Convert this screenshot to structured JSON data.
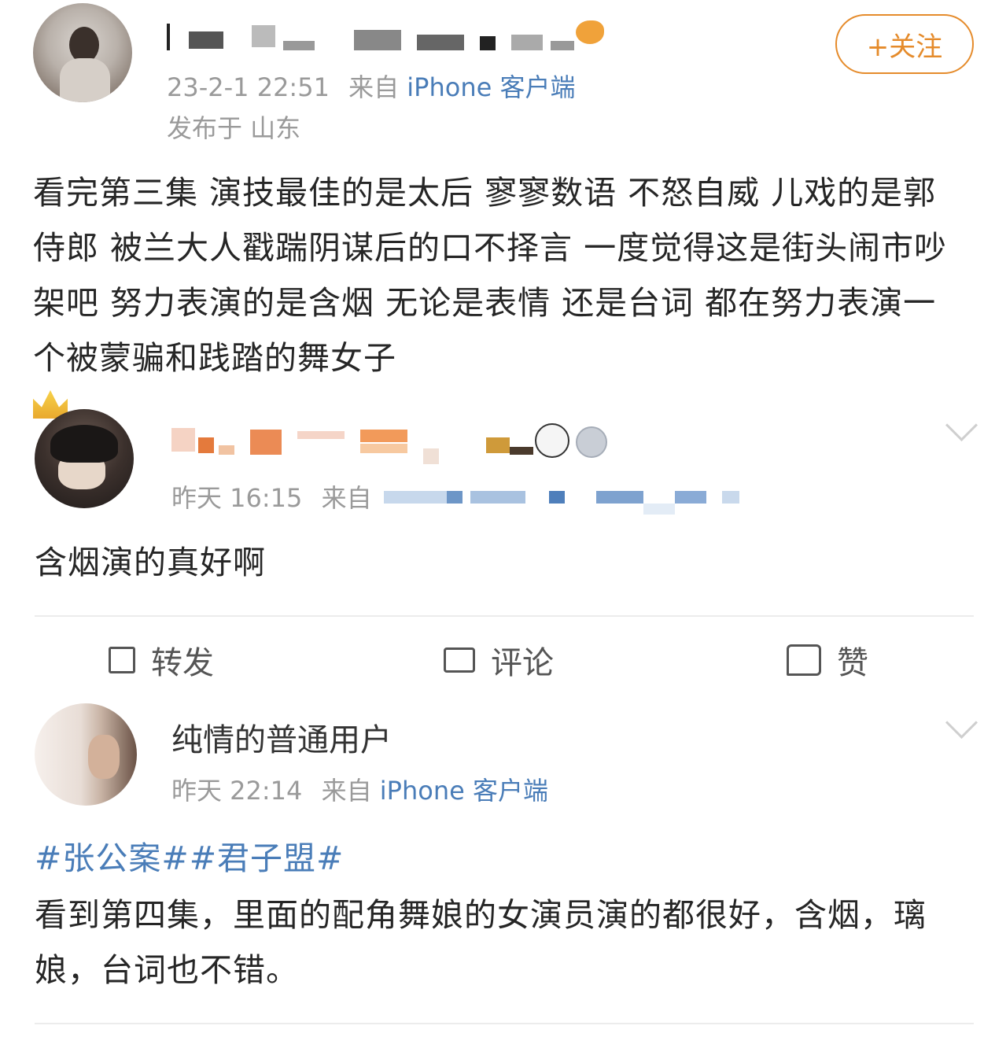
{
  "post": {
    "timestamp": "23-2-1 22:51",
    "source_prefix": "来自",
    "source_client": "iPhone 客户端",
    "location": "发布于 山东",
    "follow_label": "+关注",
    "text": "看完第三集 演技最佳的是太后 寥寥数语 不怒自威 儿戏的是郭侍郎 被兰大人戳踹阴谋后的口不择言 一度觉得这是街头闹市吵架吧 努力表演的是含烟 无论是表情 还是台词 都在努力表演一个被蒙骗和践踏的舞女子"
  },
  "comment1": {
    "timestamp": "昨天 16:15",
    "source_prefix": "来自",
    "text": "含烟演的真好啊"
  },
  "actions": {
    "repost": "转发",
    "comment": "评论",
    "like": "赞"
  },
  "comment2": {
    "username": "纯情的普通用户",
    "timestamp": "昨天 22:14",
    "source_prefix": "来自",
    "source_client": "iPhone 客户端",
    "hashtags": "#张公案##君子盟#",
    "text": "看到第四集，里面的配角舞娘的女演员演的都很好，含烟，璃娘，台词也不错。"
  },
  "colors": {
    "link": "#4a7db8",
    "follow": "#e58b2b",
    "meta": "#9a9a9a"
  }
}
